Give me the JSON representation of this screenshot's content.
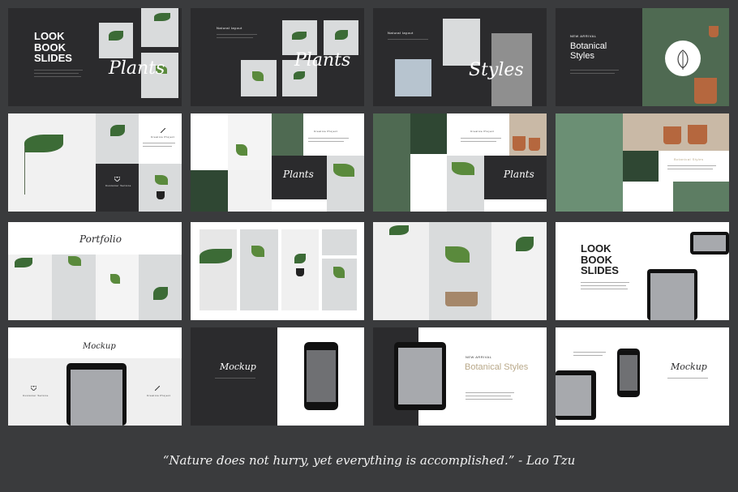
{
  "slides": {
    "s1": {
      "title": "LOOK BOOK SLIDES",
      "script": "Plants"
    },
    "s2": {
      "subtitle": "Natural layout",
      "script": "Plants"
    },
    "s3": {
      "subtitle": "Natural layout",
      "script": "Styles"
    },
    "s4": {
      "kicker": "NEW ARRIVAL",
      "title": "Botanical Styles"
    },
    "s5": {
      "label_top": "Creative Project",
      "label_bottom": "Customer Service"
    },
    "s6": {
      "label": "Creative Project",
      "script": "Plants"
    },
    "s7": {
      "label": "Creative Project",
      "script": "Plants"
    },
    "s8": {
      "label": "Botanical Styles"
    },
    "s9": {
      "script": "Portfolio"
    },
    "s12": {
      "title": "LOOK BOOK SLIDES"
    },
    "s13": {
      "script": "Mockup",
      "label_left": "Customer Service",
      "label_right": "Creative Project"
    },
    "s14": {
      "script": "Mockup"
    },
    "s15": {
      "kicker": "NEW ARRIVAL",
      "title": "Botanical Styles"
    },
    "s16": {
      "script": "Mockup"
    }
  },
  "quote": "“Nature does not hurry, yet everything is accomplished.” - Lao Tzu",
  "colors": {
    "background": "#3a3b3d",
    "dark_slide": "#2b2b2d",
    "gold_text": "#b9a98a"
  },
  "icons": [
    "leaf-icon",
    "heart-icon",
    "pencil-icon"
  ]
}
